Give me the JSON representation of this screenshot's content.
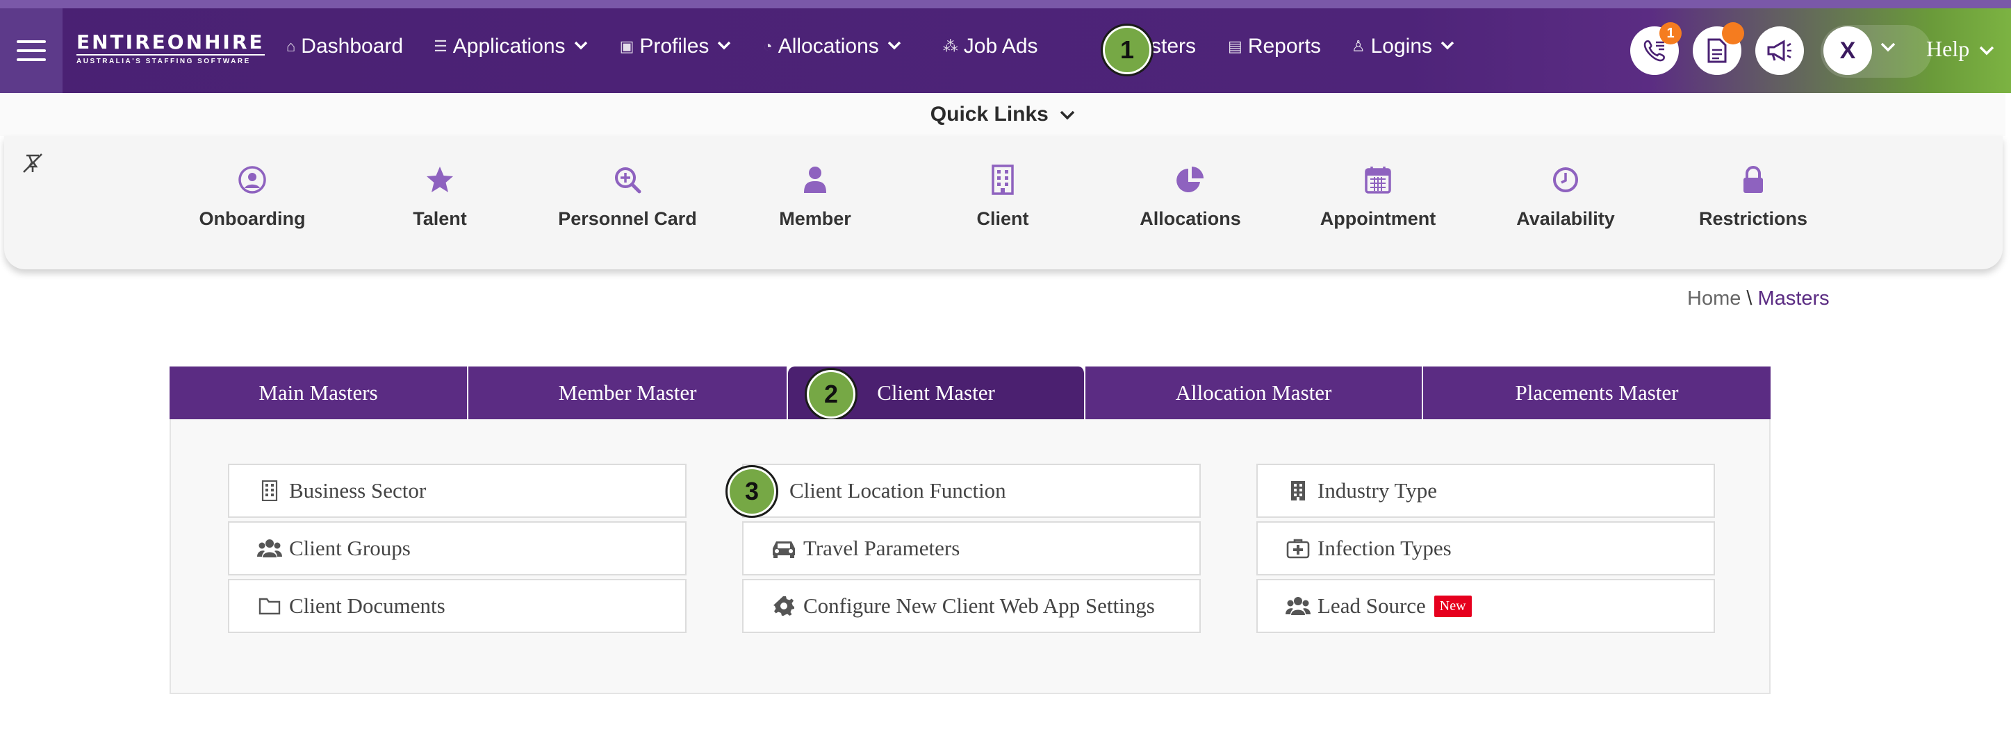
{
  "brand": {
    "name": "ENTIREONHIRE",
    "tagline": "AUSTRALIA'S STAFFING SOFTWARE"
  },
  "nav": {
    "dashboard": "Dashboard",
    "applications": "Applications",
    "profiles": "Profiles",
    "allocations": "Allocations",
    "job_ads": "Job Ads",
    "masters": "Masters",
    "reports": "Reports",
    "logins": "Logins"
  },
  "header": {
    "notification_count": "1",
    "user_initial": "X",
    "help": "Help"
  },
  "steps": {
    "one": "1",
    "two": "2",
    "three": "3"
  },
  "quick_links": {
    "title": "Quick Links",
    "items": [
      {
        "label": "Onboarding",
        "icon": "user-circle-icon"
      },
      {
        "label": "Talent",
        "icon": "star-icon"
      },
      {
        "label": "Personnel Card",
        "icon": "search-plus-icon"
      },
      {
        "label": "Member",
        "icon": "person-icon"
      },
      {
        "label": "Client",
        "icon": "building-icon"
      },
      {
        "label": "Allocations",
        "icon": "pie-chart-icon"
      },
      {
        "label": "Appointment",
        "icon": "calendar-icon"
      },
      {
        "label": "Availability",
        "icon": "clock-icon"
      },
      {
        "label": "Restrictions",
        "icon": "lock-icon"
      }
    ]
  },
  "breadcrumb": {
    "home": "Home",
    "separator": "\\",
    "current": "Masters"
  },
  "tabs": {
    "main": "Main Masters",
    "member": "Member Master",
    "client": "Client Master",
    "allocation": "Allocation Master",
    "placements": "Placements Master"
  },
  "client_master": {
    "business_sector": "Business Sector",
    "client_groups": "Client Groups",
    "client_documents": "Client Documents",
    "client_location_function": "Client Location Function",
    "travel_parameters": "Travel Parameters",
    "web_app_settings": "Configure New Client Web App Settings",
    "industry_type": "Industry Type",
    "infection_types": "Infection Types",
    "lead_source": "Lead Source",
    "new_badge": "New"
  },
  "colors": {
    "primary": "#5b2c83",
    "accent_green": "#76a845",
    "quick_link_icon": "#8e62bf",
    "new_badge": "#e6001e"
  }
}
